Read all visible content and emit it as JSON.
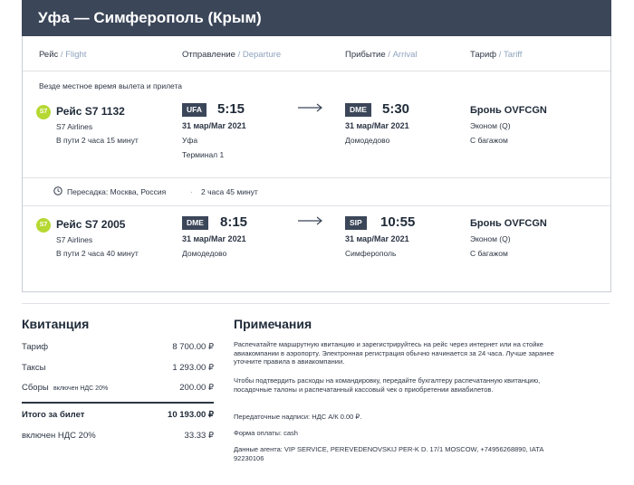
{
  "header": {
    "title": "Уфа — Симферополь (Крым)"
  },
  "columns": {
    "flight": {
      "ru": "Рейс",
      "en": "Flight"
    },
    "departure": {
      "ru": "Отправление",
      "en": "Departure"
    },
    "arrival": {
      "ru": "Прибытие",
      "en": "Arrival"
    },
    "tariff": {
      "ru": "Тариф",
      "en": "Tariff"
    },
    "separator": " / "
  },
  "local_time_note": "Везде местное время вылета и прилета",
  "segments": [
    {
      "logo": "S7",
      "flight_no": "Рейс S7 1132",
      "airline": "S7 Airlines",
      "duration": "В пути 2 часа 15 минут",
      "dep": {
        "iata": "UFA",
        "time": "5:15",
        "date": "31 мар/Mar 2021",
        "place": "Уфа",
        "terminal": "Терминал 1"
      },
      "arr": {
        "iata": "DME",
        "time": "5:30",
        "date": "31 мар/Mar 2021",
        "place": "Домодедово"
      },
      "booking": "Бронь OVFCGN",
      "class": "Эконом (Q)",
      "baggage": "С багажом"
    },
    {
      "logo": "S7",
      "flight_no": "Рейс S7 2005",
      "airline": "S7 Airlines",
      "duration": "В пути 2 часа 40 минут",
      "dep": {
        "iata": "DME",
        "time": "8:15",
        "date": "31 мар/Mar 2021",
        "place": "Домодедово"
      },
      "arr": {
        "iata": "SIP",
        "time": "10:55",
        "date": "31 мар/Mar 2021",
        "place": "Симферополь"
      },
      "booking": "Бронь OVFCGN",
      "class": "Эконом (Q)",
      "baggage": "С багажом"
    }
  ],
  "transfer": {
    "text": "Пересадка: Москва, Россия",
    "sep": "·",
    "duration": "2 часа 45 минут"
  },
  "receipt": {
    "title": "Квитанция",
    "rows": [
      {
        "label": "Тариф",
        "value": "8 700.00 ₽"
      },
      {
        "label": "Таксы",
        "value": "1 293.00 ₽"
      },
      {
        "label": "Сборы",
        "label_small": "включен НДС 20%",
        "value": "200.00 ₽"
      }
    ],
    "total": {
      "label": "Итого за билет",
      "value": "10 193.00 ₽"
    },
    "vat": {
      "label": "включен НДС 20%",
      "value": "33.33 ₽"
    }
  },
  "notes": {
    "title": "Примечания",
    "paragraphs": [
      "Распечатайте маршрутную квитанцию и зарегистрируйтесь на рейс через интернет или на стойке авиакомпании в аэропорту. Электронная регистрация обычно начинается за 24 часа. Лучше заранее уточните правила в авиакомпании.",
      "Чтобы подтвердить расходы на командировку, передайте бухгалтеру распечатанную квитанцию, посадочные талоны и распечатанный кассовый чек о приобретении авиабилетов.",
      "Передаточные надписи: НДС А/К 0.00 ₽.",
      "Форма оплаты: cash",
      "Данные агента: VIP SERVICE, PEREVEDENOVSKIJ PER-K D. 17/1 MOSCOW, +74956268890, IATA 92230106"
    ]
  },
  "colors": {
    "header_bg": "#3b4659",
    "accent_en": "#8ea3bd",
    "s7_green": "#b6d832"
  }
}
